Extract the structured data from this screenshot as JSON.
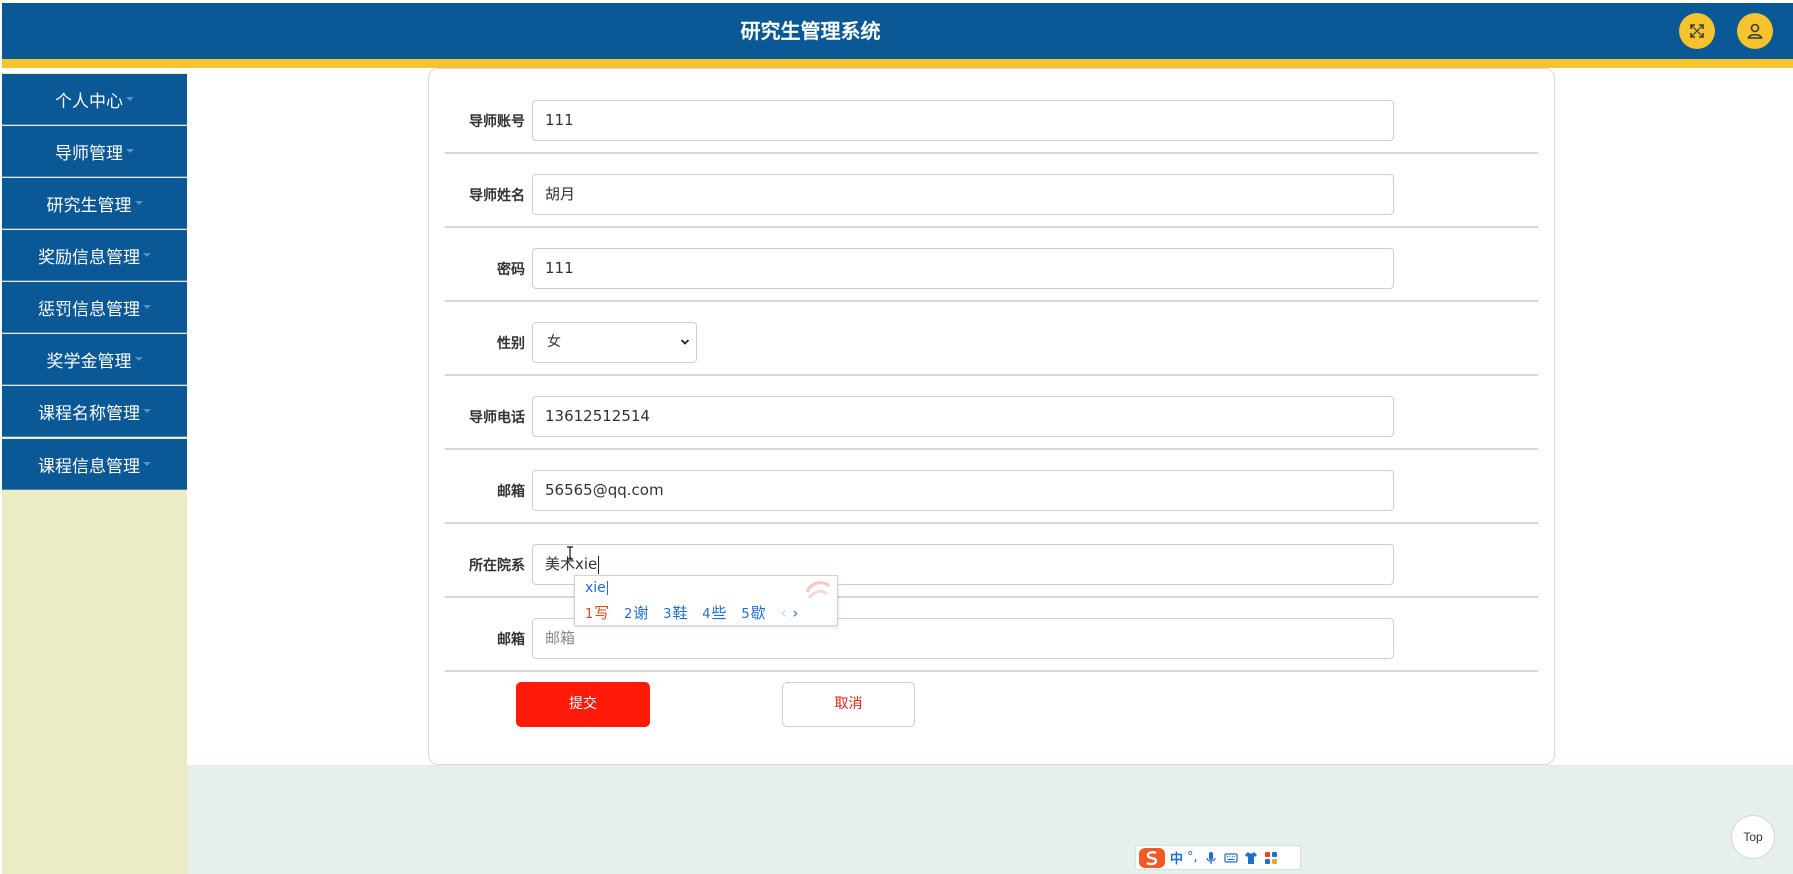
{
  "header": {
    "title": "研究生管理系统",
    "accent_color": "#0b5896",
    "strip_color": "#f5c32b",
    "fullscreen_icon": "fullscreen-icon",
    "user_icon": "user-icon"
  },
  "sidebar": {
    "items": [
      {
        "label": "个人中心"
      },
      {
        "label": "导师管理"
      },
      {
        "label": "研究生管理"
      },
      {
        "label": "奖励信息管理"
      },
      {
        "label": "惩罚信息管理"
      },
      {
        "label": "奖学金管理"
      },
      {
        "label": "课程名称管理"
      },
      {
        "label": "课程信息管理"
      }
    ]
  },
  "form": {
    "fields": [
      {
        "label": "导师账号",
        "value": "111"
      },
      {
        "label": "导师姓名",
        "value": "胡月"
      },
      {
        "label": "密码",
        "value": "111"
      },
      {
        "label": "性别",
        "value": "女"
      },
      {
        "label": "导师电话",
        "value": "13612512514"
      },
      {
        "label": "邮箱",
        "value": "56565@qq.com"
      },
      {
        "label": "所在院系",
        "value": "美术xie"
      },
      {
        "label": "邮箱",
        "value": "",
        "placeholder": "邮箱"
      }
    ],
    "submit_label": "提交",
    "cancel_label": "取消"
  },
  "ime": {
    "pinyin": "xie",
    "candidates": [
      {
        "num": "1",
        "text": "写"
      },
      {
        "num": "2",
        "text": "谢"
      },
      {
        "num": "3",
        "text": "鞋"
      },
      {
        "num": "4",
        "text": "些"
      },
      {
        "num": "5",
        "text": "歇"
      }
    ],
    "prev": "‹",
    "next": "›"
  },
  "ime_toolbar": {
    "mode": "中",
    "punct": "°,"
  },
  "back_to_top": "Top"
}
